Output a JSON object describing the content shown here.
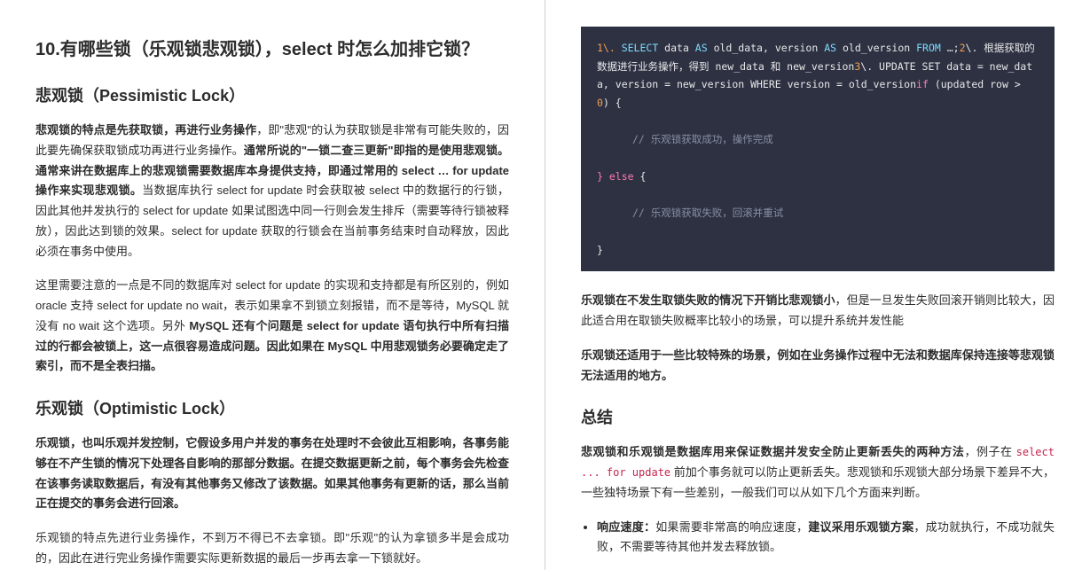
{
  "left": {
    "h2": "10.有哪些锁（乐观锁悲观锁），select 时怎么加排它锁？",
    "h3_pess": "悲观锁（Pessimistic Lock）",
    "p1_b1": "悲观锁的特点是先获取锁，再进行业务操作",
    "p1_t1": "，即\"悲观\"的认为获取锁是非常有可能失败的，因此要先确保获取锁成功再进行业务操作。",
    "p1_b2": "通常所说的\"一锁二查三更新\"即指的是使用悲观锁。通常来讲在数据库上的悲观锁需要数据库本身提供支持，即通过常用的 select … for update 操作来实现悲观锁。",
    "p1_t2": "当数据库执行 select for update 时会获取被 select 中的数据行的行锁，因此其他并发执行的 select for update 如果试图选中同一行则会发生排斥（需要等待行锁被释放），因此达到锁的效果。select for update 获取的行锁会在当前事务结束时自动释放，因此必须在事务中使用。",
    "p2_t1": "这里需要注意的一点是不同的数据库对 select for update 的实现和支持都是有所区别的，例如 oracle 支持 select for update no wait，表示如果拿不到锁立刻报错，而不是等待，MySQL 就没有 no wait 这个选项。另外 ",
    "p2_b1": "MySQL 还有个问题是 select for update 语句执行中所有扫描过的行都会被锁上，这一点很容易造成问题。因此如果在 MySQL 中用悲观锁务必要确定走了索引，而不是全表扫描。",
    "h3_opt": "乐观锁（Optimistic Lock）",
    "p3_b1": "乐观锁，也叫乐观并发控制，它假设多用户并发的事务在处理时不会彼此互相影响，各事务能够在不产生锁的情况下处理各自影响的那部分数据。在提交数据更新之前，每个事务会先检查在该事务读取数据后，有没有其他事务又修改了该数据。如果其他事务有更新的话，那么当前正在提交的事务会进行回滚。",
    "p4_t1": "乐观锁的特点先进行业务操作，不到万不得已不去拿锁。即\"乐观\"的认为拿锁多半是会成功的，因此在进行完业务操作需要实际更新数据的最后一步再去拿一下锁就好。"
  },
  "right": {
    "code": {
      "l1a": "1\\. ",
      "l1b": "SELECT",
      "l1c": " data ",
      "l1d": "AS",
      "l1e": " old_data, version ",
      "l1f": "AS",
      "l1g": " old_version ",
      "l1h": "FROM",
      "l1i": " …;",
      "l1j": "2",
      "l1k": "\\. 根据获取的数据进行业务操作，得到 ",
      "l1l": "new_data 和 new_version",
      "l1m": "3",
      "l1n": "\\. UPDATE SET data = new_data, version = new_version WHERE version = old_version",
      "l1o": "if",
      "l1p": " (updated row > ",
      "l1q": "0",
      "l1r": ") {",
      "c1": "// 乐观锁获取成功，操作完成",
      "else": "} else {",
      "c2": "// 乐观锁获取失败，回滚并重试",
      "end": "}"
    },
    "p5_b1": "乐观锁在不发生取锁失败的情况下开销比悲观锁小",
    "p5_t1": "，但是一旦发生失败回滚开销则比较大，因此适合用在取锁失败概率比较小的场景，可以提升系统并发性能",
    "p6_b1": "乐观锁还适用于一些比较特殊的场景，例如在业务操作过程中无法和数据库保持连接等悲观锁无法适用的地方。",
    "h3_sum": "总结",
    "p7_b1": "悲观锁和乐观锁是数据库用来保证数据并发安全防止更新丢失的两种方法",
    "p7_t1": "，例子在 ",
    "p7_code": "select ... for update",
    "p7_t2": " 前加个事务就可以防止更新丢失。悲观锁和乐观锁大部分场景下差异不大，一些独特场景下有一些差别，一般我们可以从如下几个方面来判断。",
    "li1_b1": "响应速度：",
    "li1_t1": "如果需要非常高的响应速度，",
    "li1_b2": "建议采用乐观锁方案",
    "li1_t2": "，成功就执行，不成功就失败，不需要等待其他并发去释放锁。"
  }
}
